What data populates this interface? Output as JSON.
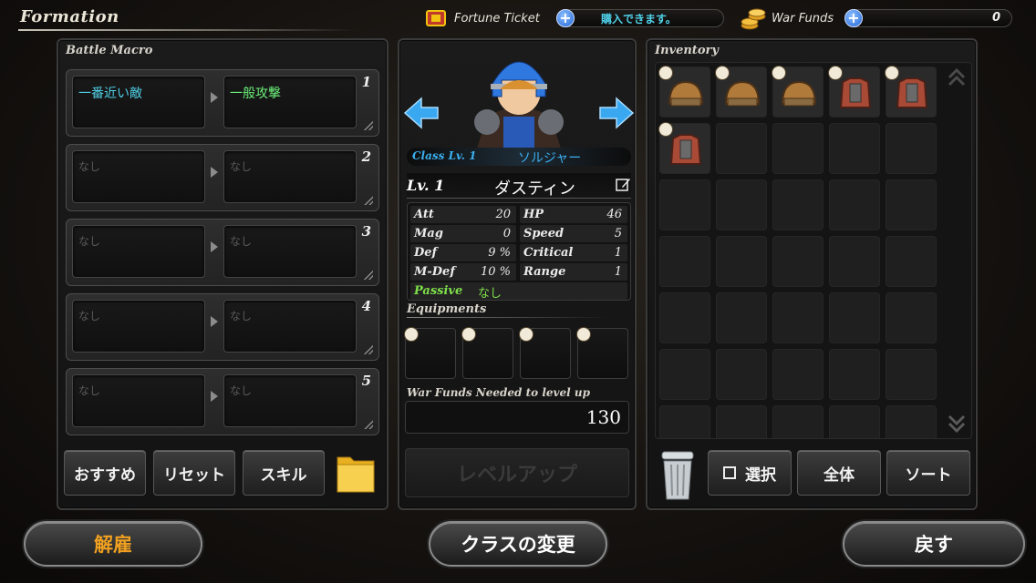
{
  "header": {
    "title": "Formation",
    "fortune_ticket_label": "Fortune Ticket",
    "fortune_ticket_value": "購入できます。",
    "war_funds_label": "War Funds",
    "war_funds_value": "0",
    "plus_symbol": "+"
  },
  "battle_macro": {
    "title": "Battle Macro",
    "rows": [
      {
        "num": "1",
        "target": "一番近い敵",
        "action": "一般攻撃",
        "active": true
      },
      {
        "num": "2",
        "target": "なし",
        "action": "なし",
        "active": false
      },
      {
        "num": "3",
        "target": "なし",
        "action": "なし",
        "active": false
      },
      {
        "num": "4",
        "target": "なし",
        "action": "なし",
        "active": false
      },
      {
        "num": "5",
        "target": "なし",
        "action": "なし",
        "active": false
      }
    ],
    "buttons": {
      "recommend": "おすすめ",
      "reset": "リセット",
      "skill": "スキル"
    },
    "folder_icon": "folder-icon"
  },
  "character": {
    "class_label": "Class Lv. 1",
    "class_name": "ソルジャー",
    "level_label": "Lv. 1",
    "name": "ダスティン",
    "stats": [
      {
        "label": "Att",
        "value": "20"
      },
      {
        "label": "HP",
        "value": "46"
      },
      {
        "label": "Mag",
        "value": "0"
      },
      {
        "label": "Speed",
        "value": "5"
      },
      {
        "label": "Def",
        "value": "9 %"
      },
      {
        "label": "Critical",
        "value": "1"
      },
      {
        "label": "M-Def",
        "value": "10 %"
      },
      {
        "label": "Range",
        "value": "1"
      }
    ],
    "passive_label": "Passive",
    "passive_value": "なし",
    "equipments_label": "Equipments",
    "level_up_label": "War Funds Needed to level up",
    "level_up_cost": "130",
    "level_up_button": "レベルアップ"
  },
  "inventory": {
    "title": "Inventory",
    "items": [
      {
        "kind": "helmet",
        "color": "#b07a3a"
      },
      {
        "kind": "helmet",
        "color": "#b07a3a"
      },
      {
        "kind": "helmet",
        "color": "#b07a3a"
      },
      {
        "kind": "armor",
        "color": "#a84a36"
      },
      {
        "kind": "armor",
        "color": "#a84a36"
      },
      {
        "kind": "armor",
        "color": "#a84a36"
      }
    ],
    "select_label": "選択",
    "all_label": "全体",
    "sort_label": "ソート"
  },
  "footer": {
    "dismiss": "解雇",
    "change_class": "クラスの変更",
    "back": "戻す"
  },
  "colors": {
    "accent_blue": "#2aa0f0",
    "macro_active_text": "#4fd0e8",
    "macro_action_text": "#6cf07a",
    "dismiss_text": "#f0a020",
    "passive_green": "#7ee04a"
  }
}
